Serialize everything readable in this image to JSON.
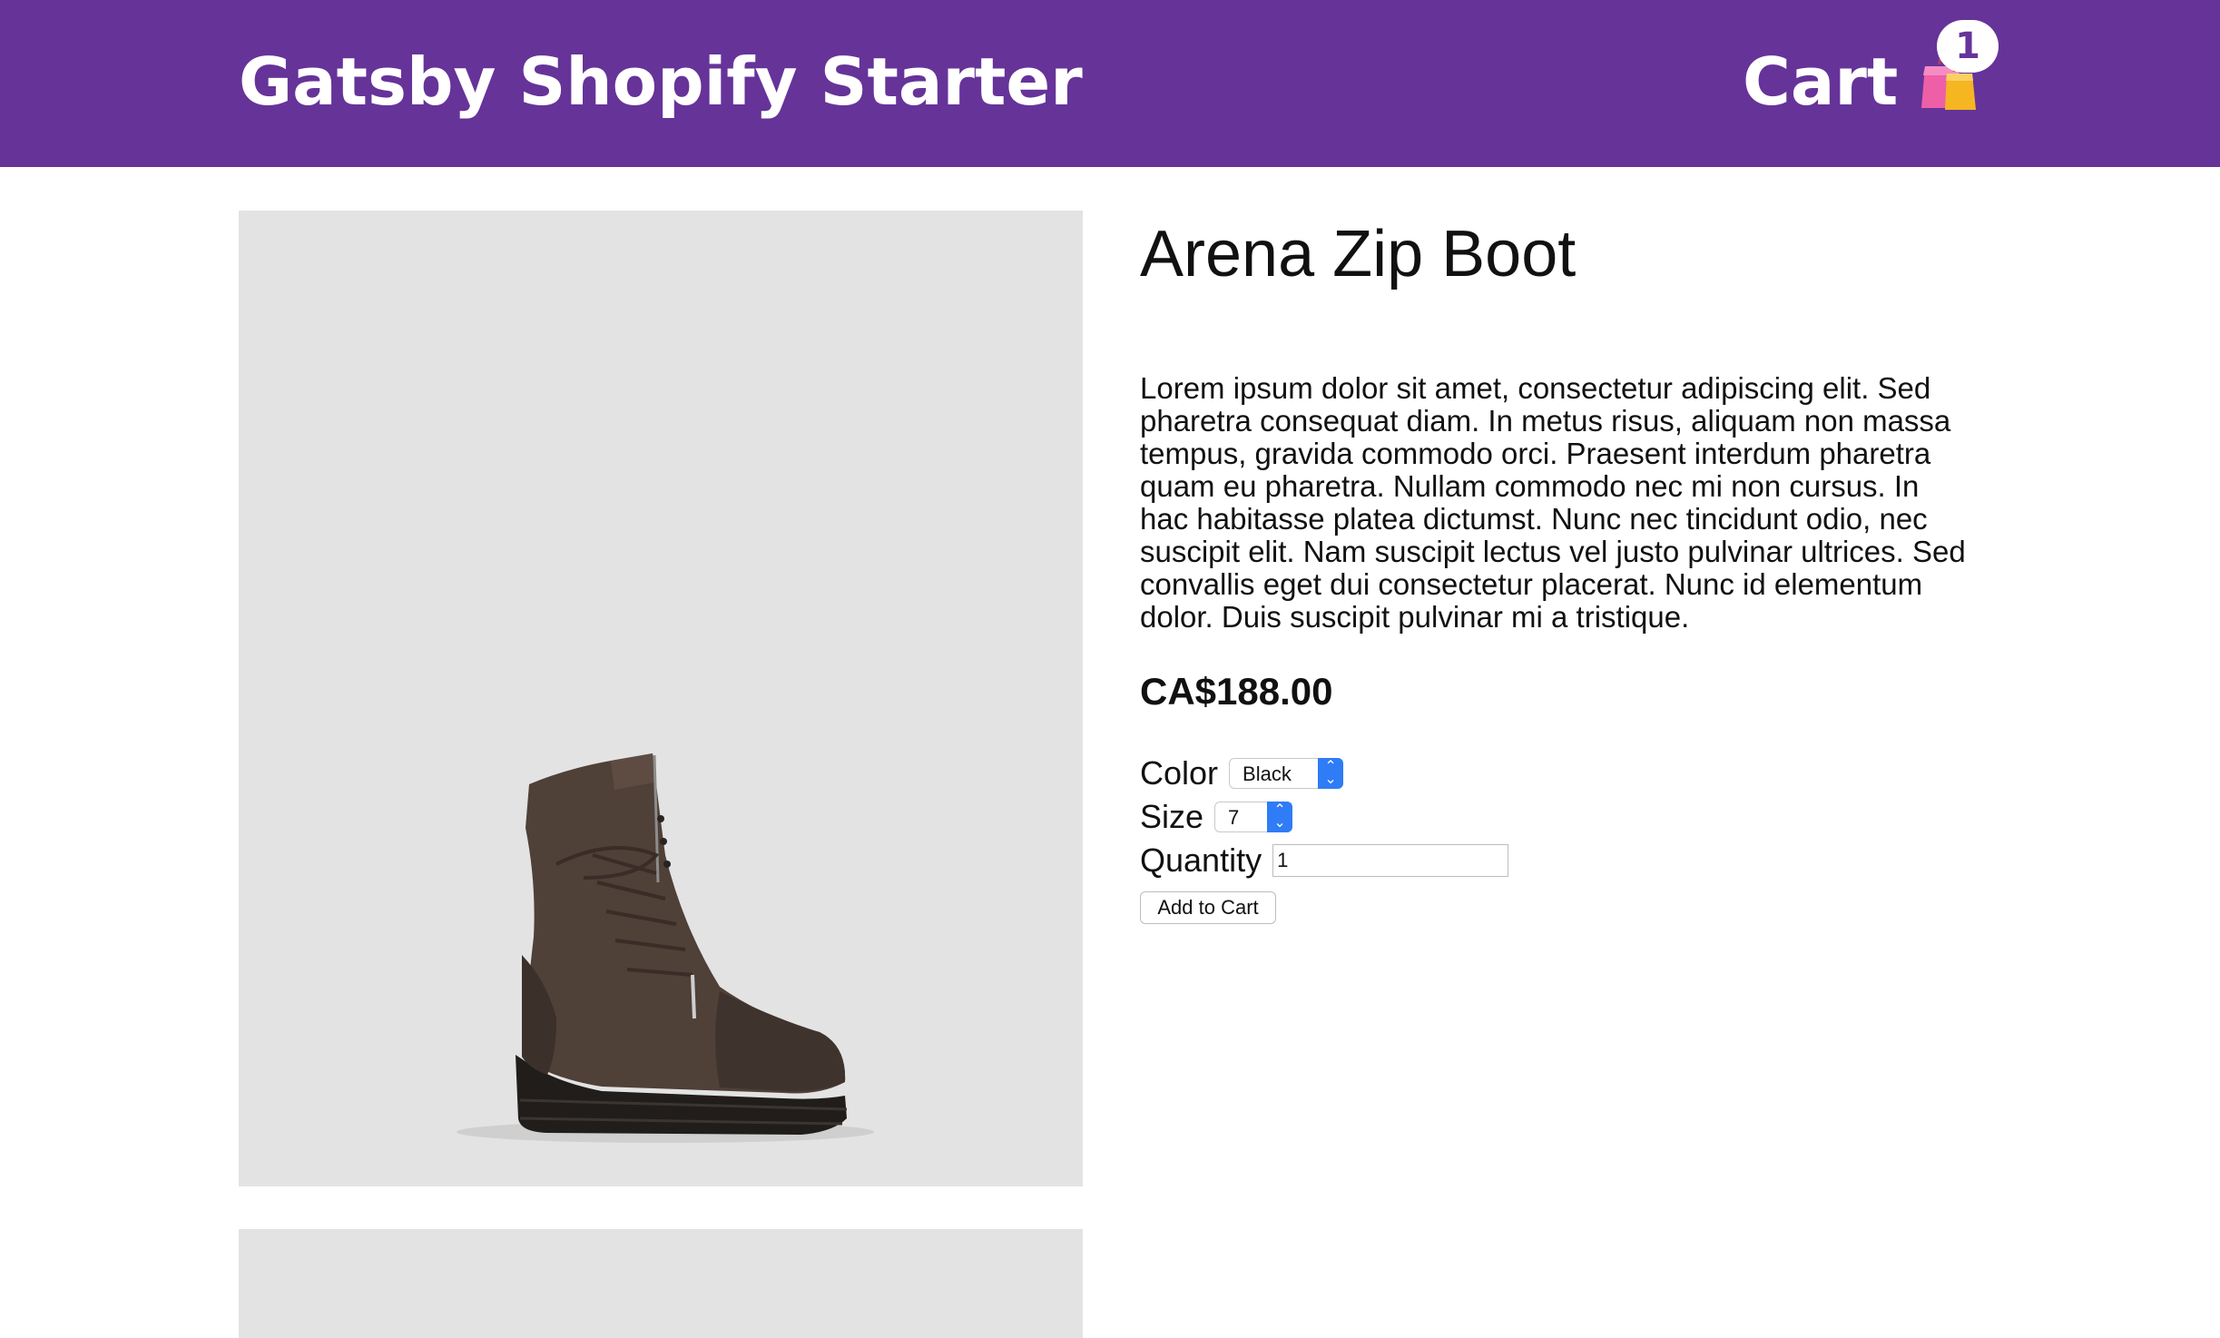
{
  "header": {
    "site_title": "Gatsby Shopify Starter",
    "cart_label": "Cart",
    "cart_count": "1",
    "cart_icon": "shopping-bags-icon",
    "background_color": "#663399"
  },
  "product": {
    "title": "Arena Zip Boot",
    "description": "Lorem ipsum dolor sit amet, consectetur adipiscing elit. Sed pharetra consequat diam. In metus risus, aliquam non massa tempus, gravida commodo orci. Praesent interdum pharetra quam eu pharetra. Nullam commodo nec mi non cursus. In hac habitasse platea dictumst. Nunc nec tincidunt odio, nec suscipit elit. Nam suscipit lectus vel justo pulvinar ultrices. Sed convallis eget dui consectetur placerat. Nunc id elementum dolor. Duis suscipit pulvinar mi a tristique.",
    "price": "CA$188.00",
    "image": "boot-photo"
  },
  "options": {
    "color_label": "Color",
    "color_value": "Black",
    "size_label": "Size",
    "size_value": "7",
    "quantity_label": "Quantity",
    "quantity_value": "1"
  },
  "actions": {
    "add_to_cart_label": "Add to Cart"
  }
}
